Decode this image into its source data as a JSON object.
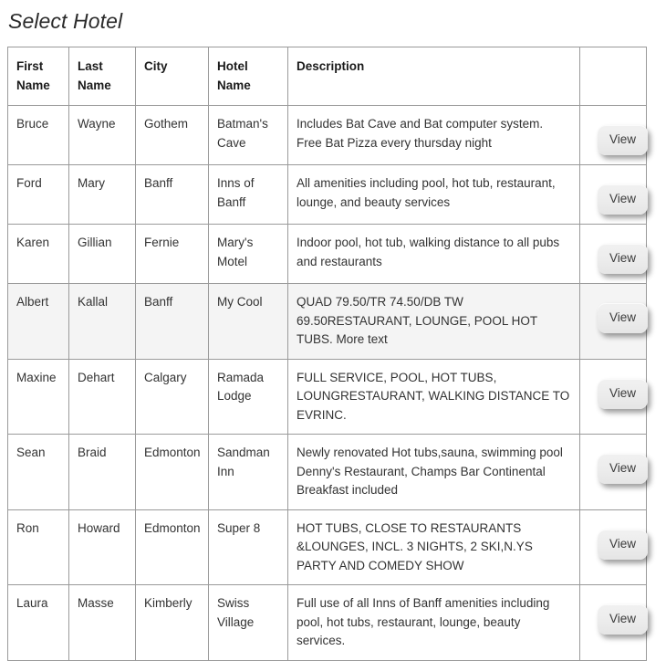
{
  "page": {
    "title": "Select Hotel"
  },
  "table": {
    "columns": [
      {
        "key": "first_name",
        "label": "First Name"
      },
      {
        "key": "last_name",
        "label": "Last Name"
      },
      {
        "key": "city",
        "label": "City"
      },
      {
        "key": "hotel_name",
        "label": "Hotel Name"
      },
      {
        "key": "description",
        "label": "Description"
      },
      {
        "key": "action",
        "label": ""
      }
    ],
    "action_label": "View",
    "selected_row_index": 3,
    "selected_row_color": "#f4f4f4",
    "border_color": "#9a9a9a",
    "rows": [
      {
        "first_name": "Bruce",
        "last_name": "Wayne",
        "city": "Gothem",
        "hotel_name": "Batman's Cave",
        "description": "Includes Bat Cave and Bat computer system. Free Bat Pizza every thursday night",
        "action": "View"
      },
      {
        "first_name": "Ford",
        "last_name": "Mary",
        "city": "Banff",
        "hotel_name": "Inns of Banff",
        "description": "All amenities including pool, hot tub, restaurant, lounge, and beauty services",
        "action": "View"
      },
      {
        "first_name": "Karen",
        "last_name": "Gillian",
        "city": "Fernie",
        "hotel_name": "Mary's Motel",
        "description": "Indoor pool, hot tub, walking distance to all pubs and restaurants",
        "action": "View"
      },
      {
        "first_name": "Albert",
        "last_name": "Kallal",
        "city": "Banff",
        "hotel_name": "My Cool",
        "description": "QUAD 79.50/TR 74.50/DB TW 69.50RESTAURANT, LOUNGE, POOL HOT TUBS. More text",
        "action": "View"
      },
      {
        "first_name": "Maxine",
        "last_name": "Dehart",
        "city": "Calgary",
        "hotel_name": "Ramada Lodge",
        "description": "FULL SERVICE, POOL, HOT TUBS, LOUNGRESTAURANT, WALKING DISTANCE TO EVRINC.",
        "action": "View"
      },
      {
        "first_name": "Sean",
        "last_name": "Braid",
        "city": "Edmonton",
        "hotel_name": "Sandman Inn",
        "description": "Newly renovated Hot tubs,sauna, swimming pool Denny's Restaurant, Champs Bar Continental Breakfast included",
        "action": "View"
      },
      {
        "first_name": "Ron",
        "last_name": "Howard",
        "city": "Edmonton",
        "hotel_name": "Super 8",
        "description": "HOT TUBS, CLOSE TO RESTAURANTS &LOUNGES, INCL. 3 NIGHTS, 2 SKI,N.YS PARTY AND COMEDY SHOW",
        "action": "View"
      },
      {
        "first_name": "Laura",
        "last_name": "Masse",
        "city": "Kimberly",
        "hotel_name": "Swiss Village",
        "description": "Full use of all Inns of Banff amenities including pool, hot tubs, restaurant, lounge, beauty services.",
        "action": "View"
      }
    ]
  }
}
